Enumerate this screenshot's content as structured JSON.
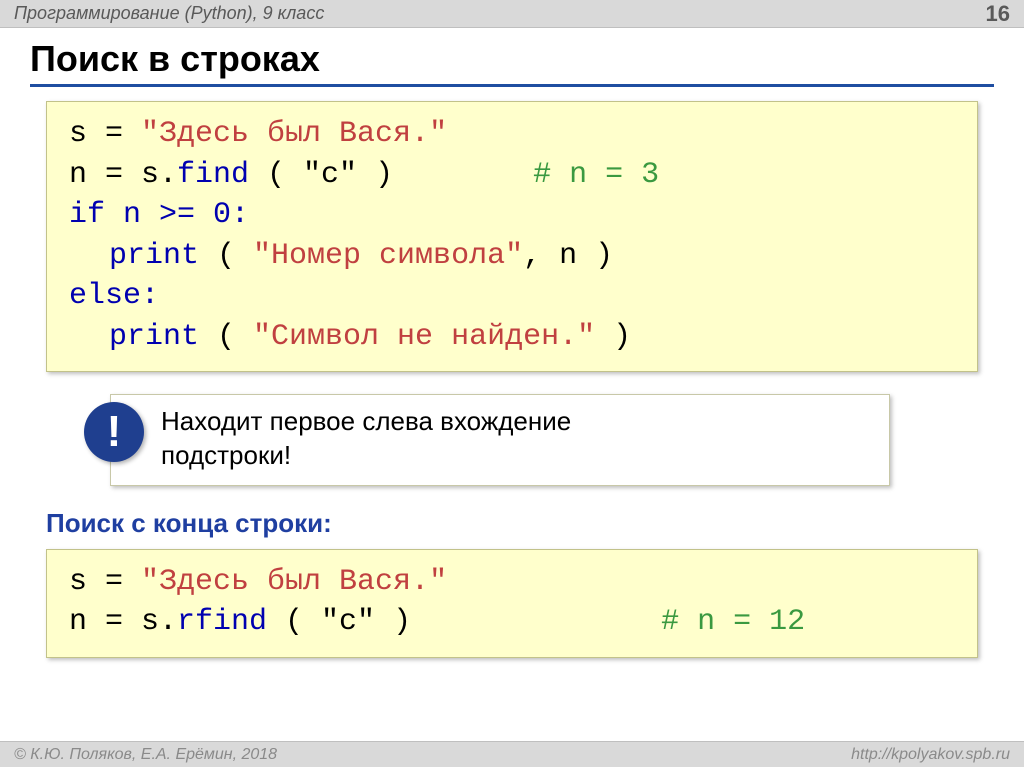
{
  "header": {
    "course": "Программирование (Python), 9 класс",
    "page_number": "16"
  },
  "title": "Поиск в строках",
  "code1": {
    "l1_pre": "s = ",
    "l1_str": "\"Здесь был Вася.\"",
    "l2_pre": "n = s.",
    "l2_func": "find",
    "l2_args": " ( \"с\" )",
    "l2_cmt": "# n = 3",
    "l3": "if n >= 0:",
    "l4_kw": "print",
    "l4_open": " ( ",
    "l4_str": "\"Номер символа\"",
    "l4_rest": ", n )",
    "l5": "else:",
    "l6_kw": "print",
    "l6_open": " ( ",
    "l6_str": "\"Символ не найден.\"",
    "l6_rest": " )"
  },
  "note": {
    "icon": "!",
    "text_line1": "Находит первое слева вхождение",
    "text_line2": "подстроки!"
  },
  "subheading": "Поиск с конца строки:",
  "code2": {
    "l1_pre": "s = ",
    "l1_str": "\"Здесь был Вася.\"",
    "l2_pre": "n = s.",
    "l2_func": "rfind",
    "l2_args": " ( \"с\" )",
    "l2_cmt": "# n = 12"
  },
  "footer": {
    "copyright": "© К.Ю. Поляков, Е.А. Ерёмин, 2018",
    "url": "http://kpolyakov.spb.ru"
  }
}
